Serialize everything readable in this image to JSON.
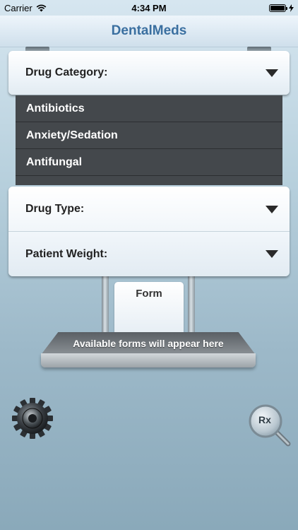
{
  "status_bar": {
    "carrier": "Carrier",
    "time": "4:34 PM",
    "battery_level": 1.0
  },
  "nav": {
    "title": "DentalMeds"
  },
  "selectors": {
    "drug_category": {
      "label": "Drug Category:"
    },
    "drug_type": {
      "label": "Drug Type:"
    },
    "patient_weight": {
      "label": "Patient Weight:"
    }
  },
  "category_list": {
    "items": [
      "Antibiotics",
      "Anxiety/Sedation",
      "Antifungal"
    ]
  },
  "form_panel": {
    "tab_label": "Form",
    "placeholder": "Available forms will appear here"
  },
  "buttons": {
    "rx_label": "Rx"
  },
  "icons": {
    "settings": "gear-icon",
    "rx_search": "magnifier-icon",
    "dropdown": "triangle-down-icon"
  },
  "colors": {
    "title": "#3a6fa0",
    "list_background": "#44484c"
  }
}
